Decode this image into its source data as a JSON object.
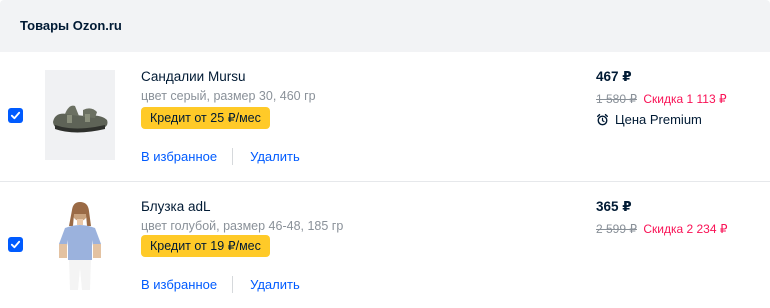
{
  "section": {
    "title": "Товары Ozon.ru"
  },
  "items": [
    {
      "name": "Сандалии Mursu",
      "attrs": "цвет серый, размер 30, 460 гр",
      "credit": "Кредит от 25 ₽/мес",
      "price": "467 ₽",
      "old_price": "1 580 ₽",
      "discount": "Скидка 1 113 ₽",
      "premium": "Цена Premium",
      "favorite_label": "В избранное",
      "delete_label": "Удалить",
      "checked": true
    },
    {
      "name": "Блузка adL",
      "attrs": "цвет голубой, размер 46-48, 185 гр",
      "credit": "Кредит от 19 ₽/мес",
      "price": "365 ₽",
      "old_price": "2 599 ₽",
      "discount": "Скидка 2 234 ₽",
      "favorite_label": "В избранное",
      "delete_label": "Удалить",
      "checked": true
    }
  ],
  "colors": {
    "accent": "#005bff",
    "discount": "#f91155",
    "credit_badge": "#ffca28",
    "header_bg": "#f2f3f5"
  }
}
